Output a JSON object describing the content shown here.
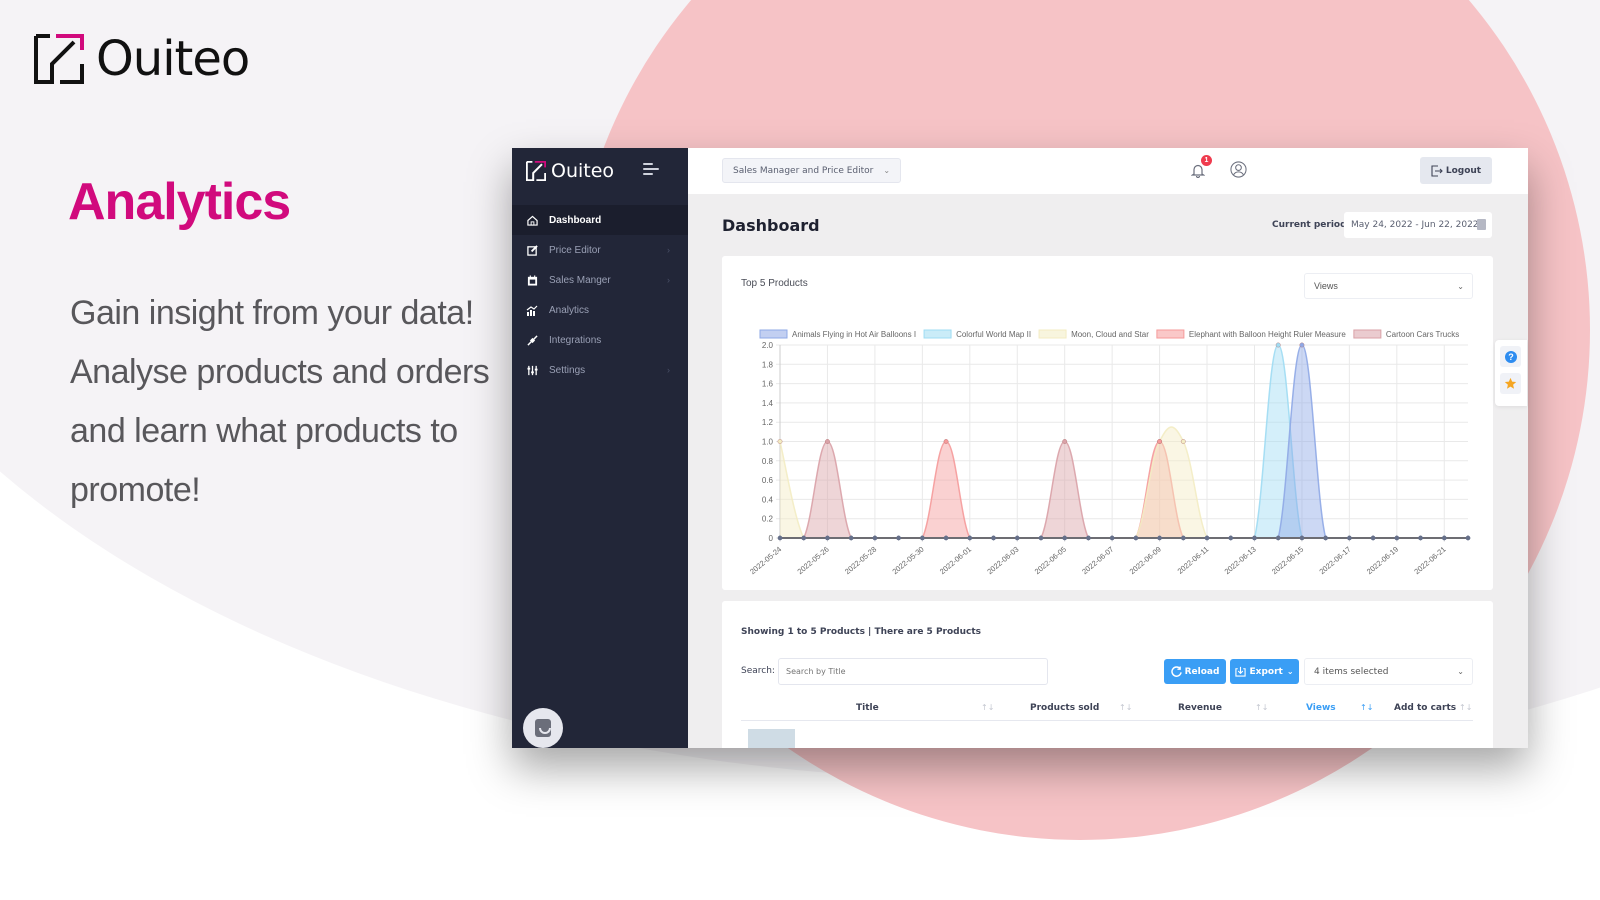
{
  "brand": {
    "name": "Ouiteo",
    "accent": "#d10a7d"
  },
  "hero": {
    "title": "Analytics",
    "lines": [
      "Gain insight from your data!",
      "Analyse products and orders",
      "and learn what products to",
      "promote!"
    ]
  },
  "app": {
    "sidebar": {
      "brand": "Ouiteo",
      "items": [
        {
          "label": "Dashboard",
          "icon": "home-icon",
          "active": true,
          "has_children": false
        },
        {
          "label": "Price Editor",
          "icon": "edit-icon",
          "active": false,
          "has_children": true
        },
        {
          "label": "Sales Manger",
          "icon": "calendar-icon",
          "active": false,
          "has_children": true
        },
        {
          "label": "Analytics",
          "icon": "chart-icon",
          "active": false,
          "has_children": false
        },
        {
          "label": "Integrations",
          "icon": "plug-icon",
          "active": false,
          "has_children": false
        },
        {
          "label": "Settings",
          "icon": "sliders-icon",
          "active": false,
          "has_children": true
        }
      ]
    },
    "topbar": {
      "role_select": "Sales Manager and Price Editor",
      "notification_count": "1",
      "logout_label": "Logout"
    },
    "page": {
      "title": "Dashboard",
      "period_label": "Current period:",
      "period_value": "May 24, 2022 - Jun 22, 2022"
    },
    "chart_card": {
      "title": "Top 5 Products",
      "metric_select": "Views"
    },
    "table_card": {
      "summary": "Showing 1 to 5 Products | There are 5 Products",
      "search_label": "Search:",
      "search_placeholder": "Search by Title",
      "reload_label": "Reload",
      "export_label": "Export",
      "columns_select": "4 items selected",
      "columns": [
        {
          "label": "Title",
          "active": false
        },
        {
          "label": "Products sold",
          "active": false
        },
        {
          "label": "Revenue",
          "active": false
        },
        {
          "label": "Views",
          "active": true
        },
        {
          "label": "Add to carts",
          "active": false
        }
      ]
    }
  },
  "chart_data": {
    "type": "area",
    "title": "Top 5 Products",
    "xlabel": "",
    "ylabel": "Views",
    "ylim": [
      0,
      2.0
    ],
    "yticks": [
      0,
      0.2,
      0.4,
      0.6,
      0.8,
      1.0,
      1.2,
      1.4,
      1.6,
      1.8,
      2.0
    ],
    "grid": true,
    "legend": "top",
    "x": [
      "2022-05-24",
      "2022-05-25",
      "2022-05-26",
      "2022-05-27",
      "2022-05-28",
      "2022-05-29",
      "2022-05-30",
      "2022-05-31",
      "2022-06-01",
      "2022-06-02",
      "2022-06-03",
      "2022-06-04",
      "2022-06-05",
      "2022-06-06",
      "2022-06-07",
      "2022-06-08",
      "2022-06-09",
      "2022-06-10",
      "2022-06-11",
      "2022-06-12",
      "2022-06-13",
      "2022-06-14",
      "2022-06-15",
      "2022-06-16",
      "2022-06-17",
      "2022-06-18",
      "2022-06-19",
      "2022-06-20",
      "2022-06-21",
      "2022-06-22"
    ],
    "xtick_labels": [
      "2022-05-24",
      "2022-05-26",
      "2022-05-28",
      "2022-05-30",
      "2022-06-01",
      "2022-06-03",
      "2022-06-05",
      "2022-06-07",
      "2022-06-09",
      "2022-06-11",
      "2022-06-13",
      "2022-06-15",
      "2022-06-17",
      "2022-06-19",
      "2022-06-21"
    ],
    "series": [
      {
        "name": "Animals Flying in Hot Air Balloons I",
        "color": "#8fa8e6",
        "values": [
          0,
          0,
          0,
          0,
          0,
          0,
          0,
          0,
          0,
          0,
          0,
          0,
          0,
          0,
          0,
          0,
          0,
          0,
          0,
          0,
          0,
          0,
          2,
          0,
          0,
          0,
          0,
          0,
          0,
          0
        ]
      },
      {
        "name": "Colorful World Map II",
        "color": "#9fdcf3",
        "values": [
          0,
          0,
          0,
          0,
          0,
          0,
          0,
          0,
          0,
          0,
          0,
          0,
          0,
          0,
          0,
          0,
          0,
          0,
          0,
          0,
          0,
          2,
          0,
          0,
          0,
          0,
          0,
          0,
          0,
          0
        ]
      },
      {
        "name": "Moon, Cloud and Star",
        "color": "#f3ecc3",
        "values": [
          1,
          0,
          0,
          0,
          0,
          0,
          0,
          0,
          0,
          0,
          0,
          0,
          0,
          0,
          0,
          0,
          1,
          1,
          0,
          0,
          0,
          0,
          0,
          0,
          0,
          0,
          0,
          0,
          0,
          0
        ]
      },
      {
        "name": "Elephant with Balloon Height Ruler Measure",
        "color": "#f59a9a",
        "values": [
          0,
          0,
          0,
          0,
          0,
          0,
          0,
          1,
          0,
          0,
          0,
          0,
          0,
          0,
          0,
          0,
          1,
          0,
          0,
          0,
          0,
          0,
          0,
          0,
          0,
          0,
          0,
          0,
          0,
          0
        ]
      },
      {
        "name": "Cartoon Cars Trucks",
        "color": "#d9a1a7",
        "values": [
          0,
          0,
          1,
          0,
          0,
          0,
          0,
          0,
          0,
          0,
          0,
          0,
          1,
          0,
          0,
          0,
          0,
          0,
          0,
          0,
          0,
          0,
          0,
          0,
          0,
          0,
          0,
          0,
          0,
          0
        ]
      }
    ]
  }
}
